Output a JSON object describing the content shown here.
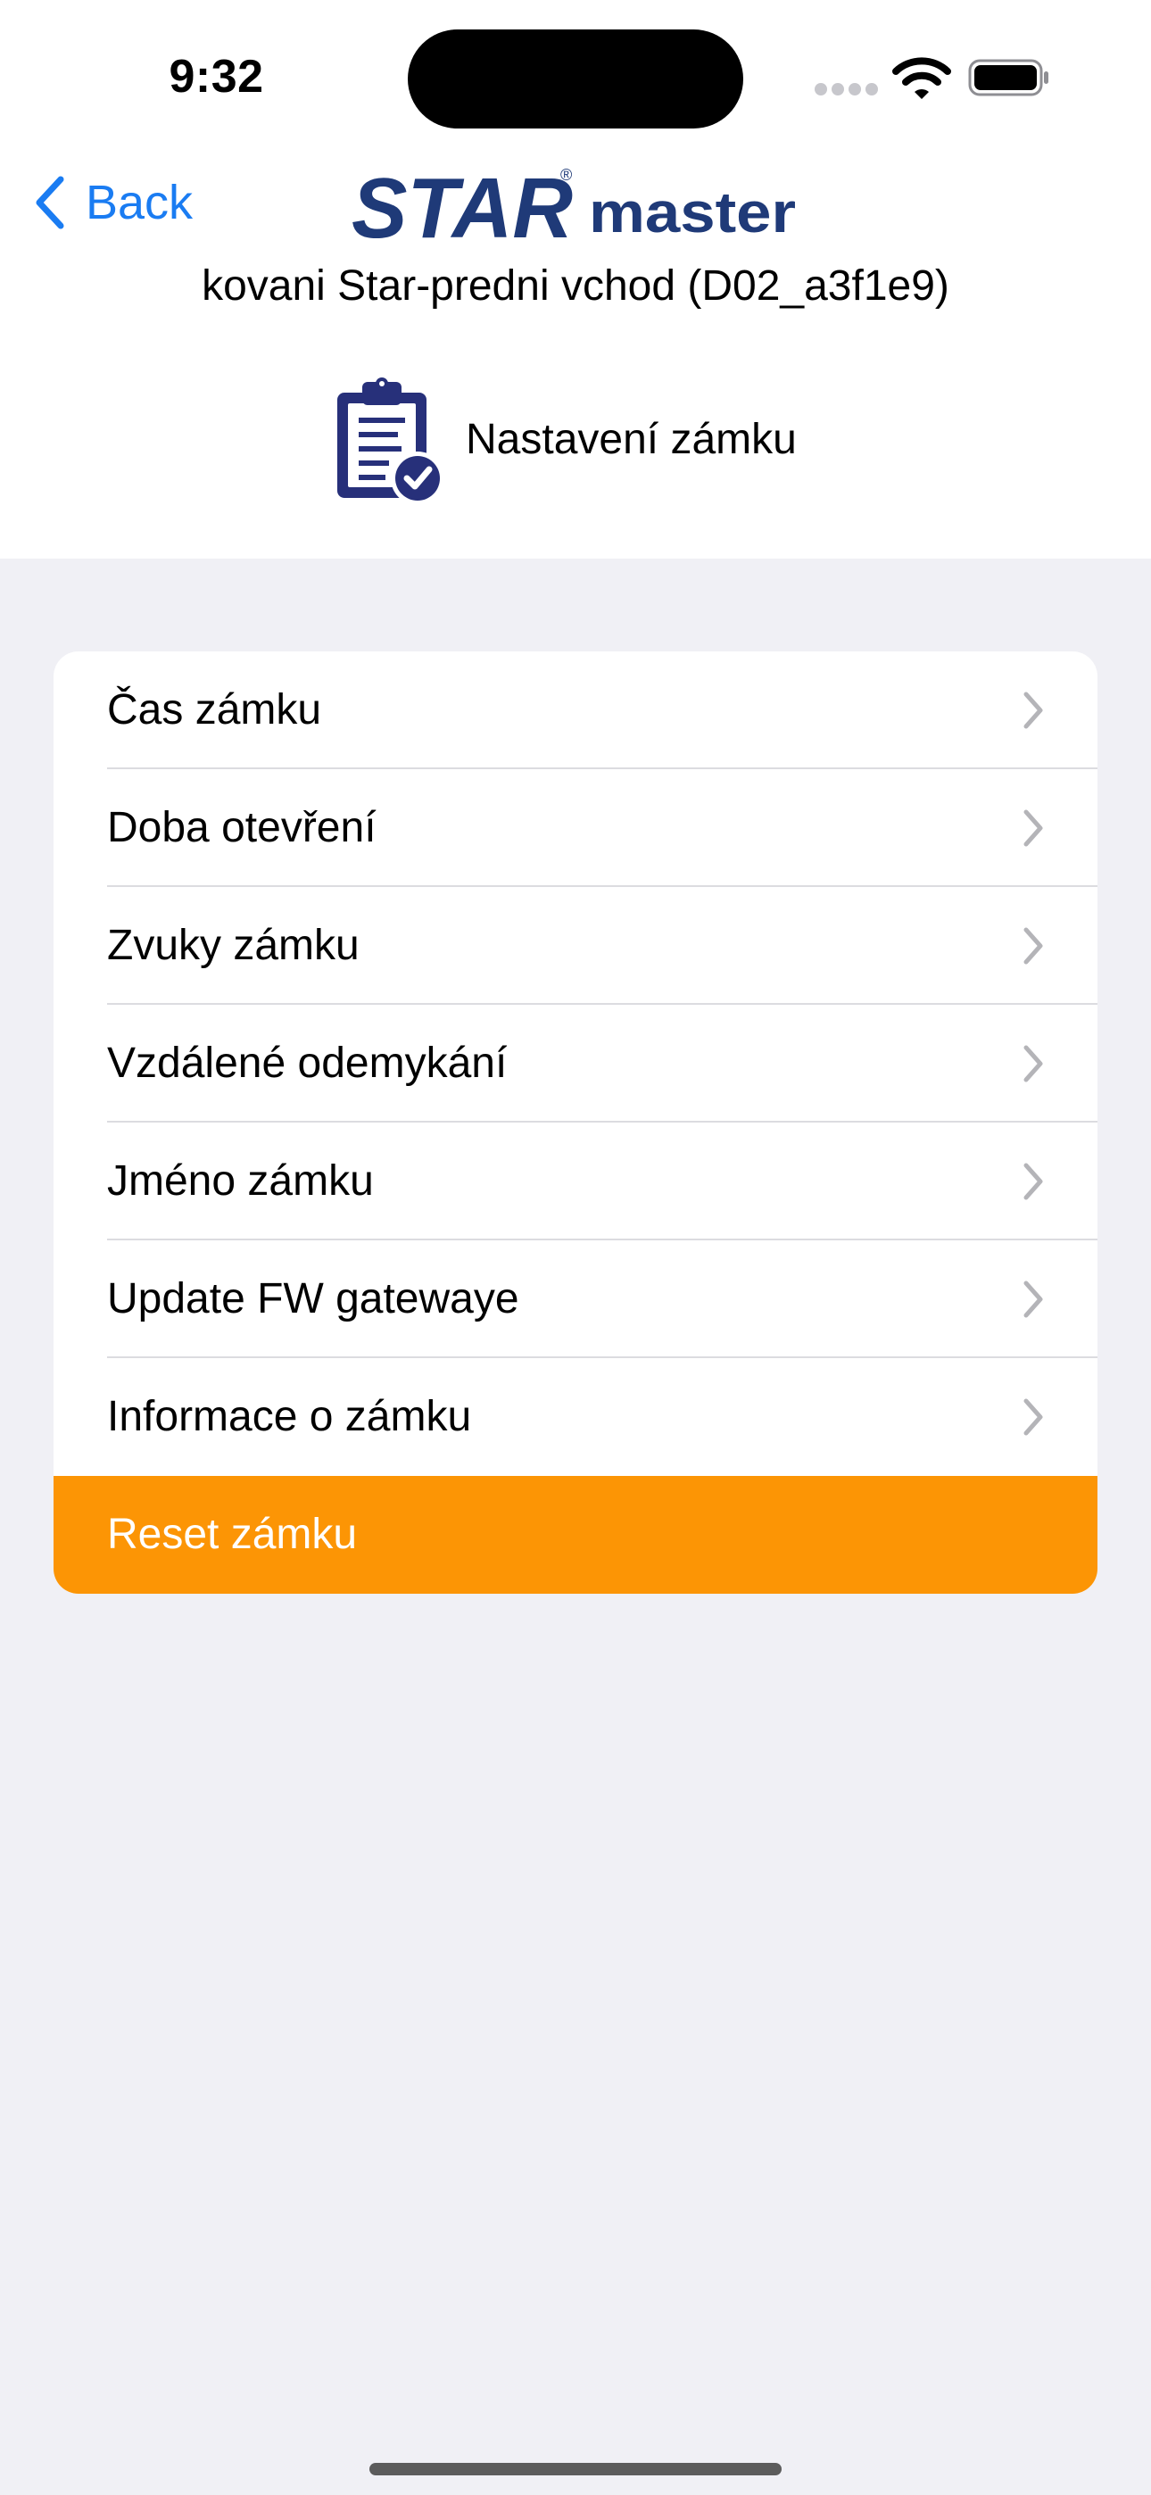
{
  "status_bar": {
    "time": "9:32",
    "icons": [
      "cellular-signal-icon",
      "wifi-icon",
      "battery-icon"
    ]
  },
  "nav": {
    "back_label": "Back",
    "logo": {
      "primary": "STAR",
      "secondary": "master",
      "registered_mark": "®"
    }
  },
  "lock": {
    "title": "kovani Star-predni vchod (D02_a3f1e9)"
  },
  "section": {
    "icon": "clipboard-check-icon",
    "title": "Nastavení zámku"
  },
  "settings": {
    "items": [
      {
        "label": "Čas zámku"
      },
      {
        "label": "Doba otevření"
      },
      {
        "label": "Zvuky zámku"
      },
      {
        "label": "Vzdálené odemykání"
      },
      {
        "label": "Jméno zámku"
      },
      {
        "label": "Update FW gatewaye"
      },
      {
        "label": "Informace o zámku"
      }
    ],
    "reset_label": "Reset zámku"
  },
  "colors": {
    "accent_blue": "#1a7cf2",
    "brand_navy": "#1f3a78",
    "reset_orange": "#fc9505",
    "background": "#f0f0f5",
    "chevron_gray": "#b4b4b8"
  }
}
